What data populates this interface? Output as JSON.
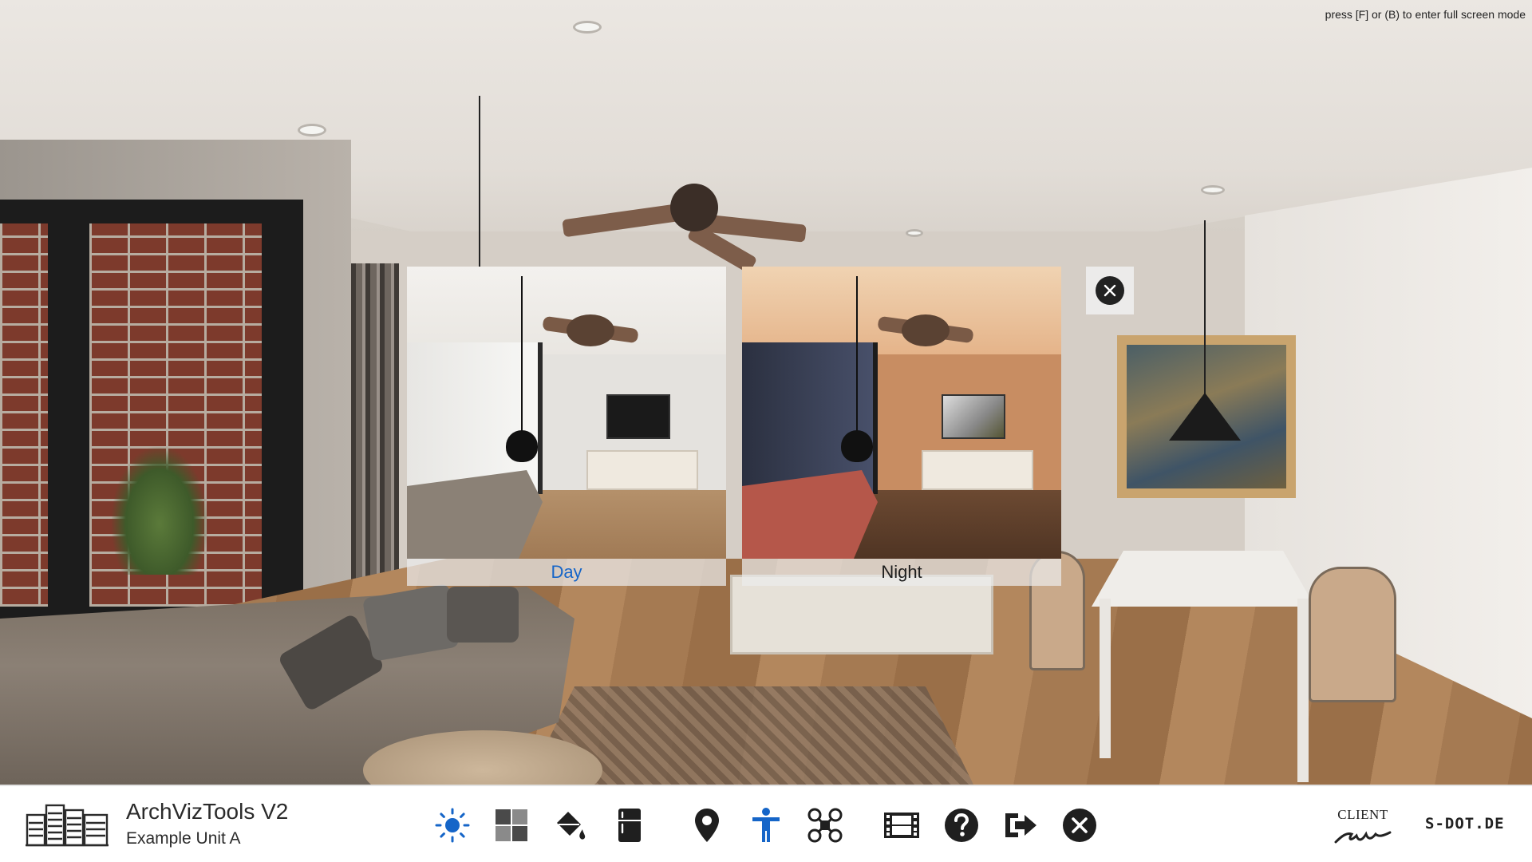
{
  "hint": {
    "fullscreen": "press [F] or (B) to enter full screen mode"
  },
  "lighting_selector": {
    "options": [
      {
        "label": "Day",
        "selected": true,
        "label_color": "#1565c8"
      },
      {
        "label": "Night",
        "selected": false,
        "label_color": "#1e1e1e"
      }
    ],
    "close_icon": "close-icon"
  },
  "toolbar": {
    "app_title": "ArchVizTools V2",
    "app_subtitle": "Example Unit A",
    "brand_icon": "buildings-icon",
    "accent_color": "#1565c8",
    "icon_color": "#1f1f1f",
    "tools": [
      {
        "name": "daylight",
        "icon": "sun-icon",
        "active": true
      },
      {
        "name": "materials",
        "icon": "material-swatch-icon",
        "active": false
      },
      {
        "name": "paint",
        "icon": "paint-bucket-icon",
        "active": false
      },
      {
        "name": "furniture",
        "icon": "fridge-icon",
        "active": false
      },
      {
        "name": "locations",
        "icon": "map-pin-icon",
        "active": false
      },
      {
        "name": "walk-mode",
        "icon": "person-icon",
        "active": true
      },
      {
        "name": "drone-mode",
        "icon": "drone-icon",
        "active": false
      },
      {
        "name": "cinematics",
        "icon": "film-icon",
        "active": false
      },
      {
        "name": "help",
        "icon": "help-icon",
        "active": false
      },
      {
        "name": "exit",
        "icon": "exit-icon",
        "active": false
      },
      {
        "name": "close",
        "icon": "close-circle-icon",
        "active": false
      }
    ],
    "client_logo_text": "CLIENT",
    "partner_logo_text": "S-DOT.DE"
  }
}
